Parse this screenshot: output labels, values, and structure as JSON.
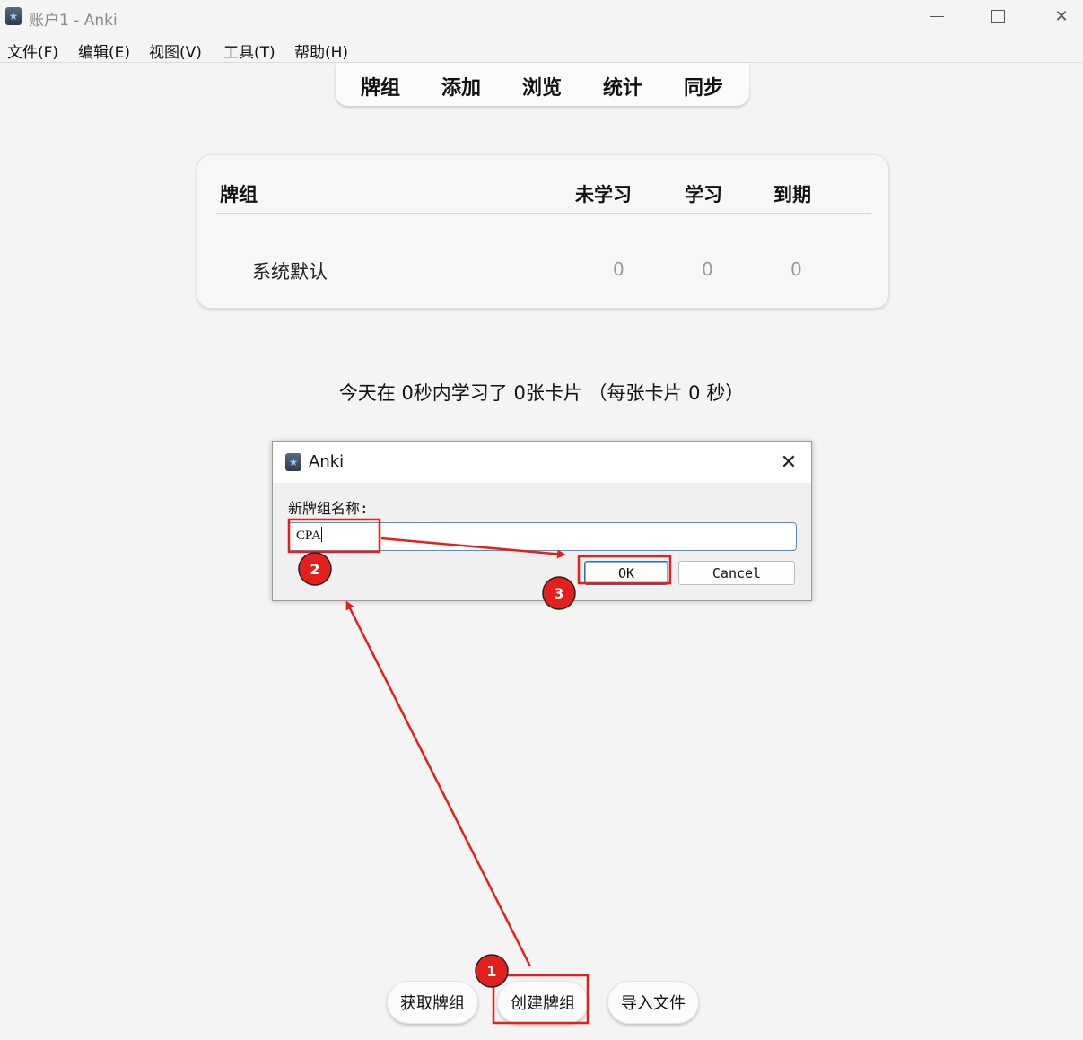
{
  "window": {
    "title": "账户1 - Anki"
  },
  "menu": [
    "文件(F)",
    "编辑(E)",
    "视图(V)",
    "工具(T)",
    "帮助(H)"
  ],
  "toolbar": [
    "牌组",
    "添加",
    "浏览",
    "统计",
    "同步"
  ],
  "deck_table": {
    "headers": {
      "deck": "牌组",
      "new": "未学习",
      "learn": "学习",
      "due": "到期"
    },
    "rows": [
      {
        "name": "系统默认",
        "new": "0",
        "learn": "0",
        "due": "0"
      }
    ]
  },
  "stats_text": "今天在 0秒内学习了 0张卡片 （每张卡片 0 秒）",
  "dialog": {
    "title": "Anki",
    "label": "新牌组名称:",
    "input_value": "CPA",
    "ok_label": "OK",
    "cancel_label": "Cancel"
  },
  "bottom_buttons": {
    "get_shared": "获取牌组",
    "create": "创建牌组",
    "import": "导入文件"
  },
  "annotations": {
    "badges": [
      "1",
      "2",
      "3"
    ],
    "color": "#e3201b"
  }
}
